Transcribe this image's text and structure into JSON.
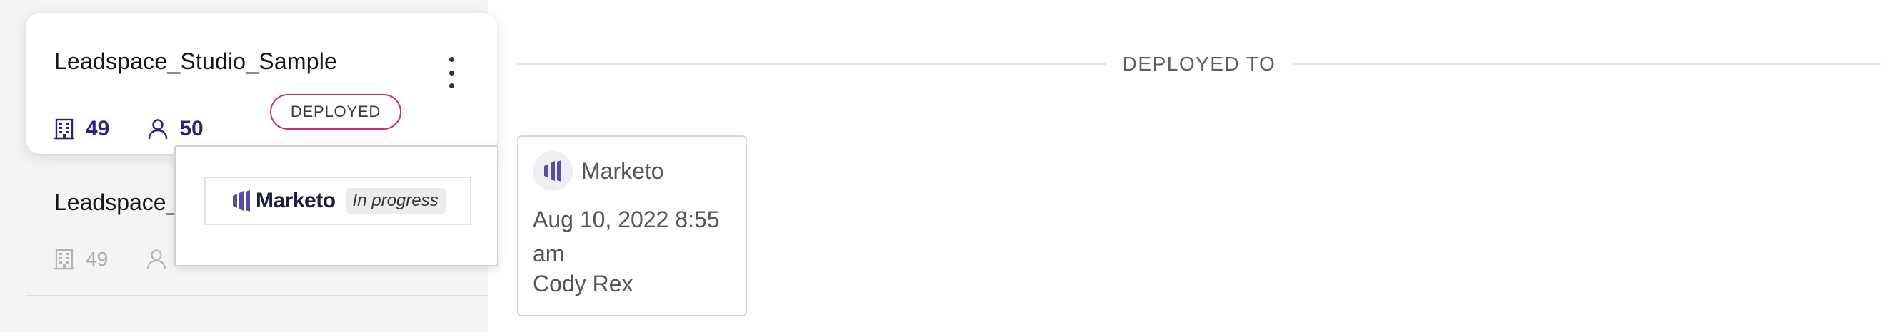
{
  "list": {
    "items": [
      {
        "title": "Leadspace_Studio_Sample",
        "accounts": "49",
        "contacts": "50",
        "status": "DEPLOYED"
      },
      {
        "title": "Leadspace_",
        "accounts": "49",
        "contacts": ""
      }
    ]
  },
  "popover": {
    "integration": "Marketo",
    "status": "In progress"
  },
  "deployed_to": {
    "header": "DEPLOYED TO",
    "destination": {
      "name": "Marketo",
      "date": "Aug 10, 2022 8:55 am",
      "user": "Cody Rex"
    }
  },
  "colors": {
    "accent": "#2c2380",
    "badge_border": "#c2306f",
    "marketo": "#5c4c9f",
    "panel_bg": "#f4f4f5"
  },
  "icons": {
    "accounts": "building-icon",
    "contacts": "person-icon",
    "menu": "kebab-menu-icon",
    "integration": "marketo-logo-icon"
  }
}
